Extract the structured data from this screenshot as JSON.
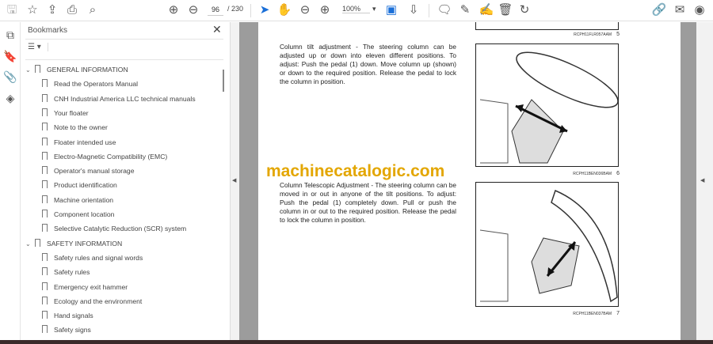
{
  "toolbar": {
    "current_page": "96",
    "total_pages": "/ 230",
    "zoom": "100%"
  },
  "bookmarks": {
    "title": "Bookmarks",
    "sections": [
      {
        "label": "GENERAL INFORMATION",
        "items": [
          "Read the Operators Manual",
          "CNH Industrial America LLC technical manuals",
          "Your floater",
          "Note to the owner",
          "Floater intended use",
          "Electro-Magnetic Compatibility (EMC)",
          "Operator's manual storage",
          "Product identification",
          "Machine orientation",
          "Component location",
          "Selective Catalytic Reduction (SCR) system"
        ]
      },
      {
        "label": "SAFETY INFORMATION",
        "items": [
          "Safety rules and signal words",
          "Safety rules",
          "Emergency exit hammer",
          "Ecology and the environment",
          "Hand signals",
          "Safety signs"
        ]
      }
    ]
  },
  "document": {
    "para1": "Column tilt adjustment - The steering column can be adjusted up or down into eleven different positions. To adjust: Push the pedal (1) down. Move column up (shown) or down to the required position. Release the pedal to lock the column in position.",
    "para2": "Column Telescopic Adjustment - The steering column can be moved in or out in anyone of the tilt positions. To adjust: Push the pedal (1) completely down. Pull or push the column in or out to the required position. Release the pedal to lock the column in position.",
    "watermark": "machinecatalogic.com",
    "figures": [
      {
        "code": "RCPH11FLR057AAM",
        "num": "5"
      },
      {
        "code": "RCPH11BEN036BAM",
        "num": "6"
      },
      {
        "code": "RCPH11BEN037BAM",
        "num": "7"
      }
    ]
  }
}
